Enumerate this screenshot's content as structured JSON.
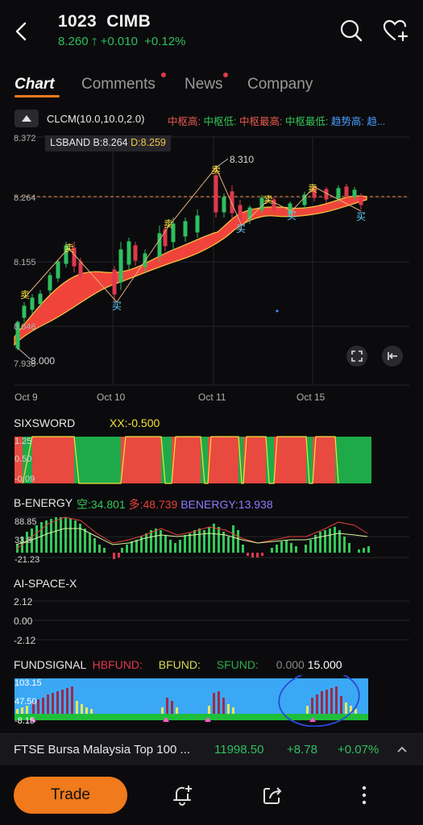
{
  "header": {
    "stock_code": "1023",
    "stock_name": "CIMB",
    "price": "8.260",
    "change": "+0.010",
    "change_pct": "+0.12%"
  },
  "tabs": [
    {
      "label": "Chart",
      "active": true
    },
    {
      "label": "Comments",
      "badge": true
    },
    {
      "label": "News",
      "badge": true
    },
    {
      "label": "Company"
    }
  ],
  "main_chart": {
    "indicator": "CLCM(10.0,10.0,2.0)",
    "legend": [
      {
        "label": "中枢高:",
        "color": "#e85a4f"
      },
      {
        "label": "中枢低:",
        "color": "#35c759"
      },
      {
        "label": "中枢最高:",
        "color": "#e85a4f"
      },
      {
        "label": "中枢最低:",
        "color": "#35c759"
      },
      {
        "label": "趋势高:",
        "color": "#4a9eff"
      },
      {
        "label": "趋...",
        "color": "#4a9eff"
      }
    ],
    "lsband": "LSBAND",
    "b_value": "B:8.264",
    "d_value": "D:8.259",
    "y_ticks": [
      "8.372",
      "8.264",
      "8.155",
      "8.046",
      "7.938"
    ],
    "x_ticks": [
      "Oct 9",
      "Oct 10",
      "Oct 11",
      "Oct 15"
    ],
    "high_label": "8.310",
    "low_label": "8.000",
    "sell_marker": "卖",
    "buy_marker": "买"
  },
  "sixsword": {
    "name": "SIXSWORD",
    "xx": "XX:-0.500",
    "y_ticks": [
      "1.25",
      "0.50",
      "-0.09"
    ]
  },
  "benergy": {
    "name": "B-ENERGY",
    "kong": "空:34.801",
    "duo": "多:48.739",
    "benergy": "BENERGY:13.938",
    "y_ticks": [
      "88.85",
      "33.8",
      "-21.23"
    ]
  },
  "aispace": {
    "name": "AI-SPACE-X",
    "y_ticks": [
      "2.12",
      "0.00",
      "-2.12"
    ]
  },
  "fundsignal": {
    "name": "FUNDSIGNAL",
    "hbfund": "HBFUND:",
    "bfund": "BFUND:",
    "sfund": "SFUND:",
    "v1": "0.000",
    "v2": "15.000",
    "y_ticks": [
      "103.15",
      "47.50",
      "-8.15"
    ]
  },
  "ticker": {
    "name": "FTSE Bursa Malaysia Top 100 ...",
    "value": "11998.50",
    "change": "+8.78",
    "pct": "+0.07%"
  },
  "bottom": {
    "trade_label": "Trade"
  },
  "colors": {
    "up": "#2fbf5f",
    "down": "#e0384c",
    "accent": "#f07a1c",
    "background": "#0b0b0d"
  }
}
